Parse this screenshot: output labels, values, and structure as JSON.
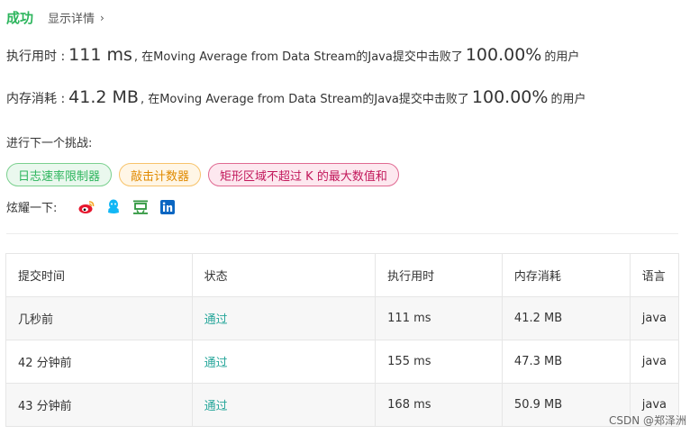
{
  "result": {
    "status": "成功",
    "details_link": "显示详情"
  },
  "runtime": {
    "label": "执行用时 :",
    "value": "111 ms",
    "text": ", 在Moving Average from Data Stream的Java提交中击败了",
    "percent": "100.00%",
    "suffix": "的用户"
  },
  "memory": {
    "label": "内存消耗 :",
    "value": "41.2 MB",
    "text": ", 在Moving Average from Data Stream的Java提交中击败了",
    "percent": "100.00%",
    "suffix": "的用户"
  },
  "next": {
    "label": "进行下一个挑战:",
    "tags": [
      "日志速率限制器",
      "敲击计数器",
      "矩形区域不超过 K 的最大数值和"
    ]
  },
  "share": {
    "label": "炫耀一下:",
    "icons": [
      "weibo-icon",
      "qq-icon",
      "douban-icon",
      "linkedin-icon"
    ]
  },
  "table": {
    "headers": [
      "提交时间",
      "状态",
      "执行用时",
      "内存消耗",
      "语言"
    ],
    "rows": [
      [
        "几秒前",
        "通过",
        "111 ms",
        "41.2 MB",
        "java"
      ],
      [
        "42 分钟前",
        "通过",
        "155 ms",
        "47.3 MB",
        "java"
      ],
      [
        "43 分钟前",
        "通过",
        "168 ms",
        "50.9 MB",
        "java"
      ]
    ]
  },
  "watermark": "CSDN @郑泽洲",
  "colors": {
    "success": "#2db55d",
    "pass": "#26a69a",
    "easy": "#2db55d",
    "medium": "#e08a00",
    "hard": "#c2185b"
  }
}
